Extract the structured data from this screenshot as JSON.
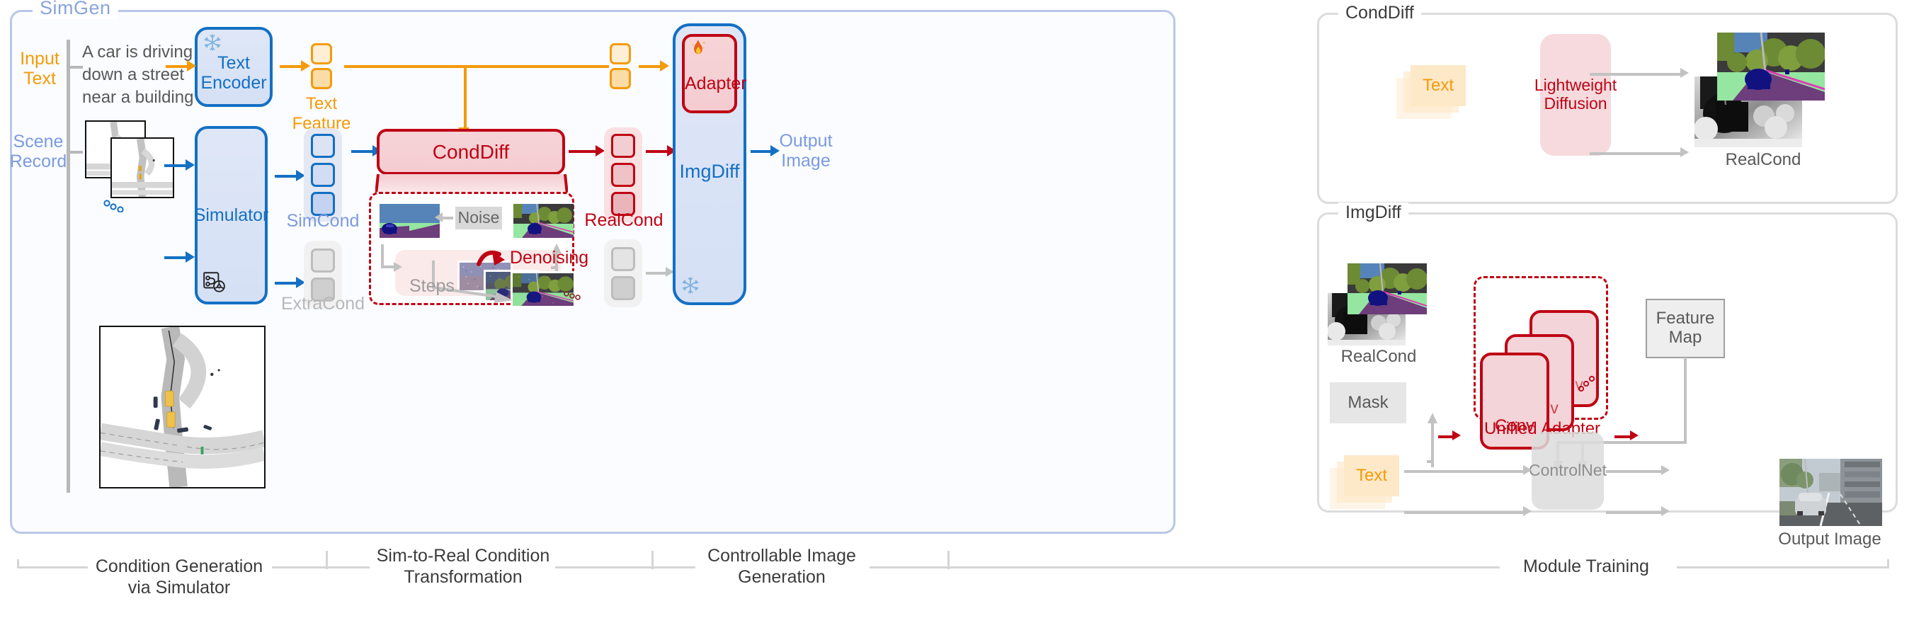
{
  "diagram": {
    "title": "SimGen",
    "type": "architecture-pipeline"
  },
  "main": {
    "input_text_label": "Input\nText",
    "input_text_label_l1": "Input",
    "input_text_label_l2": "Text",
    "prompt": "A car is driving down a street near a building",
    "prompt_l1": "A car is driving",
    "prompt_l2": "down a street",
    "prompt_l3": "near a building",
    "scene_record_l1": "Scene",
    "scene_record_l2": "Record",
    "text_encoder_l1": "Text",
    "text_encoder_l2": "Encoder",
    "text_feature_label": "Text Feature",
    "simulator_label": "Simulator",
    "simcond_label": "SimCond",
    "extracond_label": "ExtraCond",
    "conddiff_label": "CondDiff",
    "noise_label": "Noise",
    "denoising_label": "Denoising",
    "steps_label": "Steps",
    "realcond_label": "RealCond",
    "adapter_label": "Adapter",
    "imgdiff_label": "ImgDiff",
    "output_image_l1": "Output",
    "output_image_l2": "Image",
    "frozen_icon": "snowflake-icon",
    "trainable_icon": "flame-icon",
    "simulator_icon": "route-steering-icon",
    "ellipsis_icon": "ellipsis-dots-icon"
  },
  "conddiff_panel": {
    "title": "CondDiff",
    "text_label": "Text",
    "module_l1": "Lightweight",
    "module_l2": "Diffusion",
    "realcond_label": "RealCond"
  },
  "imgdiff_panel": {
    "title": "ImgDiff",
    "realcond_label": "RealCond",
    "mask_label": "Mask",
    "text_label": "Text",
    "conv_label": "Conv",
    "unified_adapter_label": "Unified Adapter",
    "feature_map_l1": "Feature",
    "feature_map_l2": "Map",
    "controlnet_label": "ControlNet",
    "output_image_label": "Output Image"
  },
  "captions": [
    {
      "id": "cap-1",
      "line1": "Condition Generation via Simulator",
      "line2": ""
    },
    {
      "id": "cap-2",
      "line1": "Sim-to-Real Condition",
      "line2": "Transformation"
    },
    {
      "id": "cap-3",
      "line1": "Controllable Image",
      "line2": "Generation"
    },
    {
      "id": "cap-4",
      "line1": "Module Training",
      "line2": ""
    }
  ],
  "colors": {
    "blue": "#1370c4",
    "light_blue": "#7c9ae0",
    "red": "#bf0414",
    "orange": "#f59a09",
    "grey": "#b0b0b0",
    "frame_blue": "#b9c7e8",
    "panel_grey": "#dcdcdc"
  }
}
